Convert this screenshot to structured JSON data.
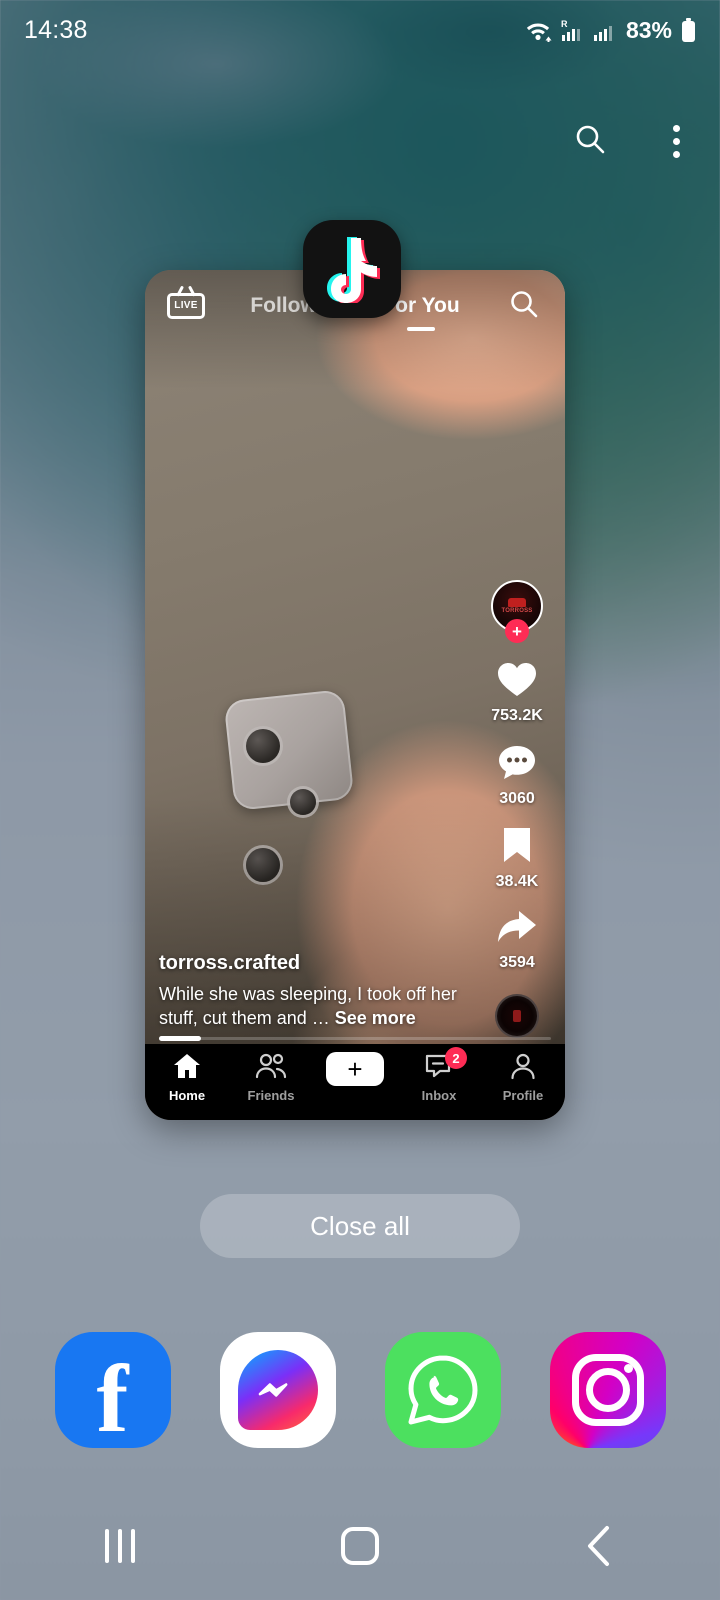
{
  "status_bar": {
    "time": "14:38",
    "battery_percent": "83%",
    "icons": [
      "wifi-icon",
      "roaming-signal-icon",
      "signal-icon",
      "battery-icon"
    ]
  },
  "recents_header": {
    "search_icon": "search-icon",
    "menu_icon": "kebab-menu-icon"
  },
  "app_card": {
    "app_icon_name": "tiktok-app-icon",
    "tiktok": {
      "live_label": "LIVE",
      "tabs": [
        {
          "label": "Following",
          "active": false
        },
        {
          "label": "For You",
          "active": true
        }
      ],
      "search_icon": "search-icon",
      "username": "torross.crafted",
      "caption": "While she was sleeping, I took off her stuff, cut them and … ",
      "see_more": "See more",
      "actions": [
        {
          "name": "like",
          "icon": "heart-icon",
          "count": "753.2K"
        },
        {
          "name": "comment",
          "icon": "comment-icon",
          "count": "3060"
        },
        {
          "name": "bookmark",
          "icon": "bookmark-icon",
          "count": "38.4K"
        },
        {
          "name": "share",
          "icon": "share-arrow-icon",
          "count": "3594"
        }
      ],
      "follow_badge": "+",
      "avatar_label": "TORROSS",
      "bottom_nav": [
        {
          "label": "Home",
          "icon": "home-icon",
          "active": true,
          "badge": ""
        },
        {
          "label": "Friends",
          "icon": "friends-icon",
          "active": false,
          "badge": ""
        },
        {
          "label": "",
          "icon": "create-plus-icon",
          "active": false,
          "badge": ""
        },
        {
          "label": "Inbox",
          "icon": "inbox-icon",
          "active": false,
          "badge": "2"
        },
        {
          "label": "Profile",
          "icon": "profile-icon",
          "active": false,
          "badge": ""
        }
      ],
      "create_label": "+"
    }
  },
  "close_all": {
    "label": "Close all"
  },
  "dock": [
    {
      "name": "facebook",
      "label": "f"
    },
    {
      "name": "messenger",
      "label": ""
    },
    {
      "name": "whatsapp",
      "label": ""
    },
    {
      "name": "instagram",
      "label": ""
    }
  ],
  "navigation_bar": {
    "recents": "recents-icon",
    "home": "home-icon",
    "back": "back-icon"
  },
  "colors": {
    "tiktok_pink": "#fe2c55",
    "tiktok_cyan": "#25f4ee",
    "facebook_blue": "#1877f2",
    "whatsapp_green": "#4ce05f",
    "wallpaper_slate": "#8e99a7"
  }
}
